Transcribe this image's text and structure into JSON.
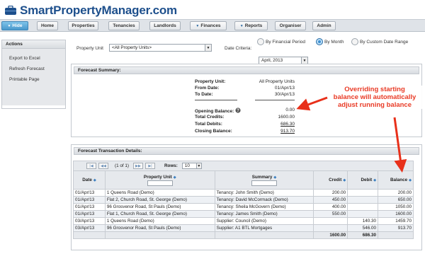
{
  "brand": {
    "name": "SmartPropertyManager.com",
    "colors": {
      "brand": "#1d4f8c",
      "accent": "#4a98cc",
      "annotation": "#e8301a"
    }
  },
  "nav": {
    "hide": "Hide",
    "home": "Home",
    "properties": "Properties",
    "tenancies": "Tenancies",
    "landlords": "Landlords",
    "finances": "Finances",
    "reports": "Reports",
    "organiser": "Organiser",
    "admin": "Admin"
  },
  "actions": {
    "title": "Actions",
    "items": [
      "Export to Excel",
      "Refresh Forecast",
      "Printable Page"
    ]
  },
  "filters": {
    "property_unit_label": "Property Unit",
    "property_unit_value": "<All Property Units>",
    "date_criteria_label": "Date Criteria:",
    "radios": [
      "By Financial Period",
      "By Month",
      "By Custom Date Range"
    ],
    "selected": "By Month",
    "month_value": "April, 2013"
  },
  "summary": {
    "title": "Forecast Summary:",
    "rows": [
      {
        "k": "Property Unit:",
        "v": "All Property Units"
      },
      {
        "k": "From Date:",
        "v": "01/Apr/13"
      },
      {
        "k": "To Date:",
        "v": "30/Apr/13"
      },
      {
        "k": "Opening Balance:",
        "v": "0.00"
      },
      {
        "k": "Total Credits:",
        "v": "1600.00"
      },
      {
        "k": "Total Debits:",
        "v": "686.30"
      },
      {
        "k": "Closing Balance:",
        "v": "913.70"
      }
    ]
  },
  "details": {
    "title": "Forecast Transaction Details:",
    "pager": "(1 of 1)",
    "rows_label": "Rows:",
    "rows_value": "10",
    "columns": [
      "Date",
      "Property Unit",
      "Summary",
      "Credit",
      "Debit",
      "Balance"
    ],
    "rows": [
      [
        "01/Apr/13",
        "1 Queens Road (Demo)",
        "Tenancy: John Smith (Demo)",
        "200.00",
        "",
        "200.00"
      ],
      [
        "01/Apr/13",
        "Flat 2, Church Road, St. George (Demo)",
        "Tenancy: David McCormack (Demo)",
        "450.00",
        "",
        "650.00"
      ],
      [
        "01/Apr/13",
        "96 Grosvenor Road, St Pauls (Demo)",
        "Tenancy: Sheila McGovern (Demo)",
        "400.00",
        "",
        "1050.00"
      ],
      [
        "01/Apr/13",
        "Flat 1, Church Road, St. George (Demo)",
        "Tenancy: James Smith (Demo)",
        "550.00",
        "",
        "1600.00"
      ],
      [
        "03/Apr/13",
        "1 Queens Road (Demo)",
        "Supplier: Council (Demo)",
        "",
        "140.30",
        "1459.70"
      ],
      [
        "03/Apr/13",
        "96 Grosvenor Road, St Pauls (Demo)",
        "Supplier: A1 BTL Mortgages",
        "",
        "546.00",
        "913.70"
      ]
    ],
    "totals": {
      "credit": "1600.00",
      "debit": "686.30"
    }
  },
  "annotation": {
    "lines": [
      "Overriding starting",
      "balance will automatically",
      "adjust running balance"
    ]
  }
}
